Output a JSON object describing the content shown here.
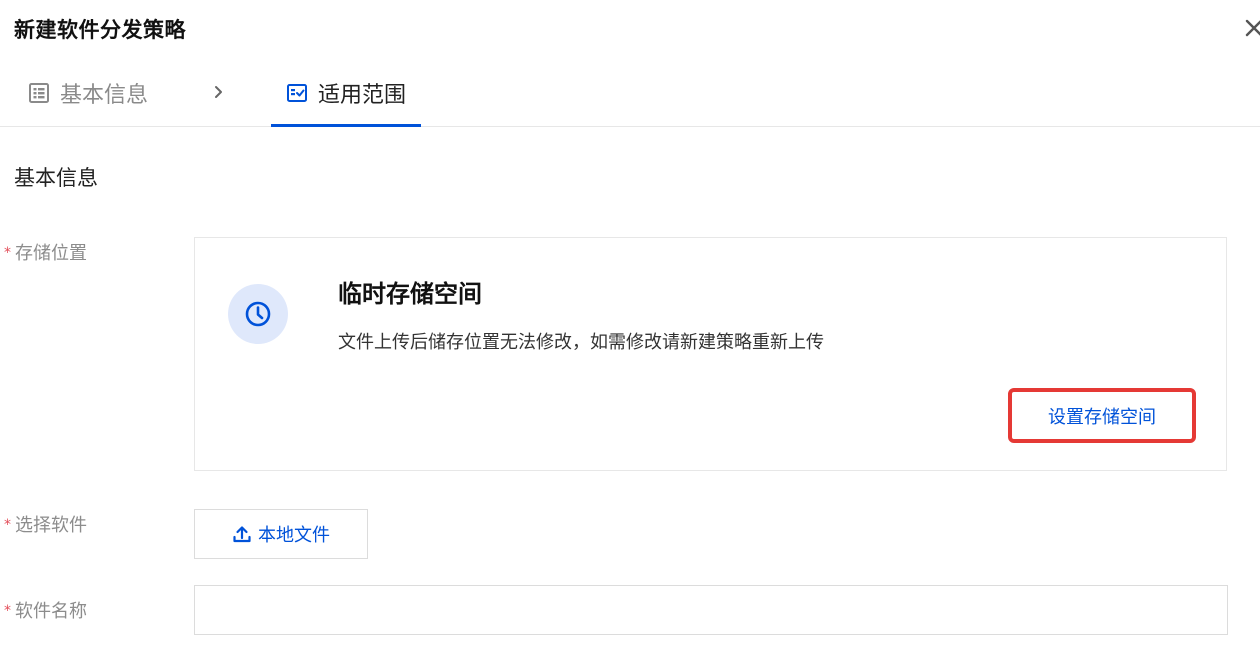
{
  "dialog": {
    "title": "新建软件分发策略"
  },
  "steps": [
    {
      "label": "基本信息",
      "icon": "list-doc-icon",
      "state": "done"
    },
    {
      "label": "适用范围",
      "icon": "checklist-icon",
      "state": "active"
    }
  ],
  "section": {
    "title": "基本信息"
  },
  "form": {
    "storage_label": "存储位置",
    "software_label": "选择软件",
    "name_label": "软件名称",
    "required_mark": "*"
  },
  "storage_card": {
    "title": "临时存储空间",
    "description": "文件上传后储存位置无法修改，如需修改请新建策略重新上传",
    "button_label": "设置存储空间",
    "icon": "clock-icon"
  },
  "upload": {
    "button_label": "本地文件",
    "icon": "upload-icon"
  },
  "name_input": {
    "value": "",
    "placeholder": ""
  },
  "colors": {
    "primary": "#0052d9",
    "highlight_border": "#e53935",
    "required": "#e34d59",
    "muted": "#8c8c8c"
  }
}
